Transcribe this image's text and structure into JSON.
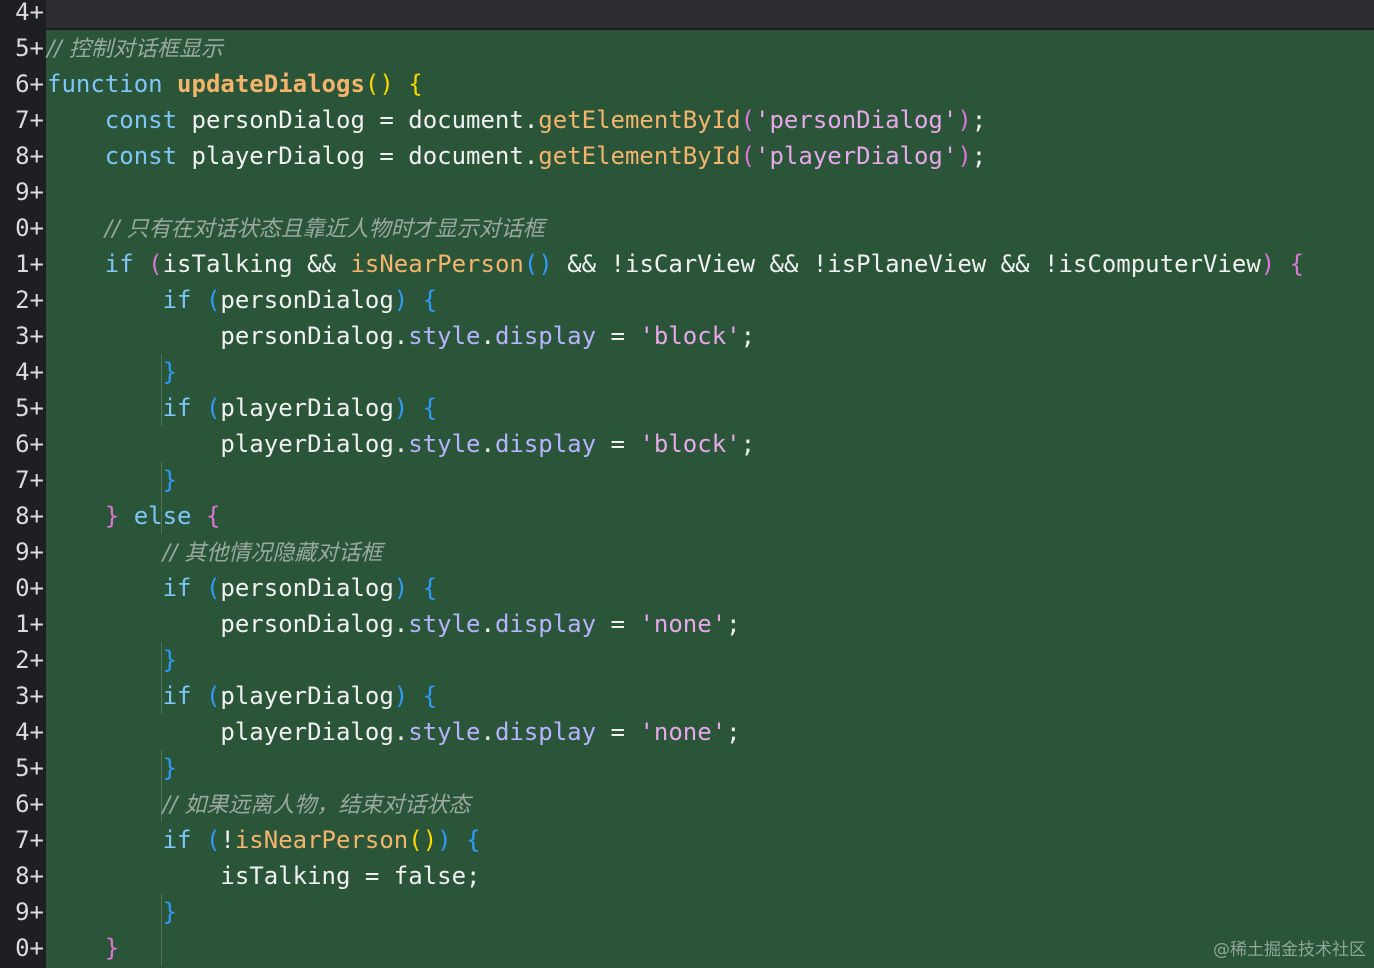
{
  "editor": {
    "lines": [
      {
        "num": "4+",
        "tokens": []
      },
      {
        "num": "5+",
        "tokens": [
          {
            "t": "// 控制对话框显示",
            "c": "cmt"
          }
        ]
      },
      {
        "num": "6+",
        "tokens": [
          {
            "t": "function ",
            "c": "kw"
          },
          {
            "t": "updateDialogs",
            "c": "fnname"
          },
          {
            "t": "()",
            "c": "p1"
          },
          {
            "t": " ",
            "c": "plain"
          },
          {
            "t": "{",
            "c": "p1"
          }
        ]
      },
      {
        "num": "7+",
        "tokens": [
          {
            "t": "    ",
            "c": "plain"
          },
          {
            "t": "const ",
            "c": "kw"
          },
          {
            "t": "personDialog = document.",
            "c": "plain"
          },
          {
            "t": "getElementById",
            "c": "mth"
          },
          {
            "t": "(",
            "c": "p2"
          },
          {
            "t": "'personDialog'",
            "c": "str"
          },
          {
            "t": ")",
            "c": "p2"
          },
          {
            "t": ";",
            "c": "plain"
          }
        ]
      },
      {
        "num": "8+",
        "tokens": [
          {
            "t": "    ",
            "c": "plain"
          },
          {
            "t": "const ",
            "c": "kw"
          },
          {
            "t": "playerDialog = document.",
            "c": "plain"
          },
          {
            "t": "getElementById",
            "c": "mth"
          },
          {
            "t": "(",
            "c": "p2"
          },
          {
            "t": "'playerDialog'",
            "c": "str"
          },
          {
            "t": ")",
            "c": "p2"
          },
          {
            "t": ";",
            "c": "plain"
          }
        ]
      },
      {
        "num": "9+",
        "tokens": []
      },
      {
        "num": "0+",
        "tokens": [
          {
            "t": "    ",
            "c": "plain"
          },
          {
            "t": "// 只有在对话状态且靠近人物时才显示对话框",
            "c": "cmt"
          }
        ]
      },
      {
        "num": "1+",
        "tokens": [
          {
            "t": "    ",
            "c": "plain"
          },
          {
            "t": "if ",
            "c": "kw"
          },
          {
            "t": "(",
            "c": "p2"
          },
          {
            "t": "isTalking && ",
            "c": "plain"
          },
          {
            "t": "isNearPerson",
            "c": "mth"
          },
          {
            "t": "()",
            "c": "p3"
          },
          {
            "t": " && !isCarView && !isPlaneView && !isComputerView",
            "c": "plain"
          },
          {
            "t": ")",
            "c": "p2"
          },
          {
            "t": " ",
            "c": "plain"
          },
          {
            "t": "{",
            "c": "p2"
          }
        ]
      },
      {
        "num": "2+",
        "tokens": [
          {
            "t": "        ",
            "c": "plain"
          },
          {
            "t": "if ",
            "c": "kw"
          },
          {
            "t": "(",
            "c": "p3"
          },
          {
            "t": "personDialog",
            "c": "plain"
          },
          {
            "t": ")",
            "c": "p3"
          },
          {
            "t": " ",
            "c": "plain"
          },
          {
            "t": "{",
            "c": "p3"
          }
        ]
      },
      {
        "num": "3+",
        "tokens": [
          {
            "t": "            personDialog.",
            "c": "plain"
          },
          {
            "t": "style",
            "c": "prop"
          },
          {
            "t": ".",
            "c": "plain"
          },
          {
            "t": "display",
            "c": "prop"
          },
          {
            "t": " = ",
            "c": "plain"
          },
          {
            "t": "'block'",
            "c": "str"
          },
          {
            "t": ";",
            "c": "plain"
          }
        ]
      },
      {
        "num": "4+",
        "tokens": [
          {
            "t": "        ",
            "c": "plain"
          },
          {
            "t": "}",
            "c": "p3"
          }
        ]
      },
      {
        "num": "5+",
        "tokens": [
          {
            "t": "        ",
            "c": "plain"
          },
          {
            "t": "if ",
            "c": "kw"
          },
          {
            "t": "(",
            "c": "p3"
          },
          {
            "t": "playerDialog",
            "c": "plain"
          },
          {
            "t": ")",
            "c": "p3"
          },
          {
            "t": " ",
            "c": "plain"
          },
          {
            "t": "{",
            "c": "p3"
          }
        ]
      },
      {
        "num": "6+",
        "tokens": [
          {
            "t": "            playerDialog.",
            "c": "plain"
          },
          {
            "t": "style",
            "c": "prop"
          },
          {
            "t": ".",
            "c": "plain"
          },
          {
            "t": "display",
            "c": "prop"
          },
          {
            "t": " = ",
            "c": "plain"
          },
          {
            "t": "'block'",
            "c": "str"
          },
          {
            "t": ";",
            "c": "plain"
          }
        ]
      },
      {
        "num": "7+",
        "tokens": [
          {
            "t": "        ",
            "c": "plain"
          },
          {
            "t": "}",
            "c": "p3"
          }
        ]
      },
      {
        "num": "8+",
        "tokens": [
          {
            "t": "    ",
            "c": "plain"
          },
          {
            "t": "}",
            "c": "p2"
          },
          {
            "t": " ",
            "c": "plain"
          },
          {
            "t": "else ",
            "c": "kw"
          },
          {
            "t": "{",
            "c": "p2"
          }
        ]
      },
      {
        "num": "9+",
        "tokens": [
          {
            "t": "        ",
            "c": "plain"
          },
          {
            "t": "// 其他情况隐藏对话框",
            "c": "cmt"
          }
        ]
      },
      {
        "num": "0+",
        "tokens": [
          {
            "t": "        ",
            "c": "plain"
          },
          {
            "t": "if ",
            "c": "kw"
          },
          {
            "t": "(",
            "c": "p3"
          },
          {
            "t": "personDialog",
            "c": "plain"
          },
          {
            "t": ")",
            "c": "p3"
          },
          {
            "t": " ",
            "c": "plain"
          },
          {
            "t": "{",
            "c": "p3"
          }
        ]
      },
      {
        "num": "1+",
        "tokens": [
          {
            "t": "            personDialog.",
            "c": "plain"
          },
          {
            "t": "style",
            "c": "prop"
          },
          {
            "t": ".",
            "c": "plain"
          },
          {
            "t": "display",
            "c": "prop"
          },
          {
            "t": " = ",
            "c": "plain"
          },
          {
            "t": "'none'",
            "c": "str"
          },
          {
            "t": ";",
            "c": "plain"
          }
        ]
      },
      {
        "num": "2+",
        "tokens": [
          {
            "t": "        ",
            "c": "plain"
          },
          {
            "t": "}",
            "c": "p3"
          }
        ]
      },
      {
        "num": "3+",
        "tokens": [
          {
            "t": "        ",
            "c": "plain"
          },
          {
            "t": "if ",
            "c": "kw"
          },
          {
            "t": "(",
            "c": "p3"
          },
          {
            "t": "playerDialog",
            "c": "plain"
          },
          {
            "t": ")",
            "c": "p3"
          },
          {
            "t": " ",
            "c": "plain"
          },
          {
            "t": "{",
            "c": "p3"
          }
        ]
      },
      {
        "num": "4+",
        "tokens": [
          {
            "t": "            playerDialog.",
            "c": "plain"
          },
          {
            "t": "style",
            "c": "prop"
          },
          {
            "t": ".",
            "c": "plain"
          },
          {
            "t": "display",
            "c": "prop"
          },
          {
            "t": " = ",
            "c": "plain"
          },
          {
            "t": "'none'",
            "c": "str"
          },
          {
            "t": ";",
            "c": "plain"
          }
        ]
      },
      {
        "num": "5+",
        "tokens": [
          {
            "t": "        ",
            "c": "plain"
          },
          {
            "t": "}",
            "c": "p3"
          }
        ]
      },
      {
        "num": "6+",
        "tokens": [
          {
            "t": "        ",
            "c": "plain"
          },
          {
            "t": "// 如果远离人物，结束对话状态",
            "c": "cmt"
          }
        ]
      },
      {
        "num": "7+",
        "tokens": [
          {
            "t": "        ",
            "c": "plain"
          },
          {
            "t": "if ",
            "c": "kw"
          },
          {
            "t": "(",
            "c": "p3"
          },
          {
            "t": "!",
            "c": "plain"
          },
          {
            "t": "isNearPerson",
            "c": "mth"
          },
          {
            "t": "()",
            "c": "p1"
          },
          {
            "t": ")",
            "c": "p3"
          },
          {
            "t": " ",
            "c": "plain"
          },
          {
            "t": "{",
            "c": "p3"
          }
        ]
      },
      {
        "num": "8+",
        "tokens": [
          {
            "t": "            isTalking = false;",
            "c": "plain"
          }
        ]
      },
      {
        "num": "9+",
        "tokens": [
          {
            "t": "        ",
            "c": "plain"
          },
          {
            "t": "}",
            "c": "p3"
          }
        ]
      },
      {
        "num": "0+",
        "tokens": [
          {
            "t": "    ",
            "c": "plain"
          },
          {
            "t": "}",
            "c": "p2"
          }
        ]
      }
    ]
  },
  "watermark": "@稀土掘金技术社区"
}
